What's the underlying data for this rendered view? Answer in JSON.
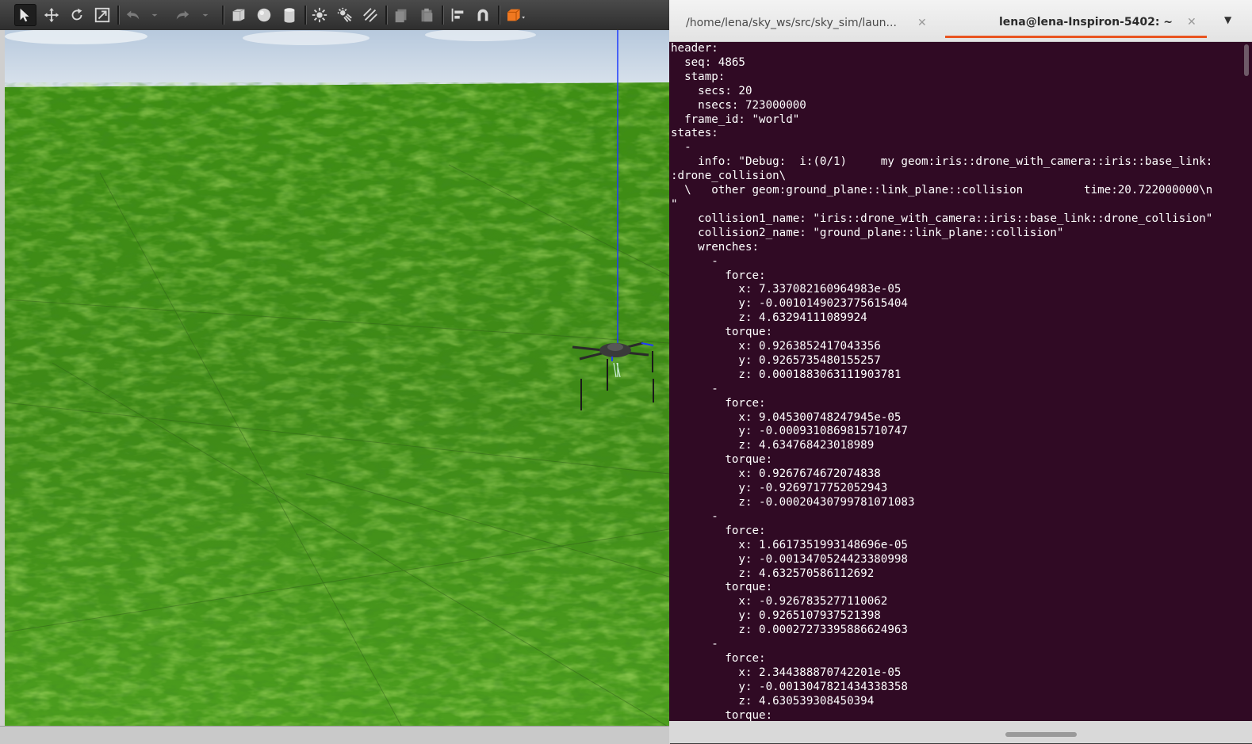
{
  "gazebo": {
    "toolbar": {
      "buttons": [
        {
          "name": "select-mode-button",
          "icon": "arrow-pointer-icon"
        },
        {
          "name": "translate-mode-button",
          "icon": "move-arrows-icon"
        },
        {
          "name": "rotate-mode-button",
          "icon": "rotate-icon"
        },
        {
          "name": "scale-mode-button",
          "icon": "scale-icon"
        },
        {
          "name": "undo-button",
          "icon": "undo-icon"
        },
        {
          "name": "redo-button",
          "icon": "redo-icon"
        },
        {
          "name": "box-shape-button",
          "icon": "box-icon"
        },
        {
          "name": "sphere-shape-button",
          "icon": "sphere-icon"
        },
        {
          "name": "cylinder-shape-button",
          "icon": "cylinder-icon"
        },
        {
          "name": "point-light-button",
          "icon": "point-light-icon"
        },
        {
          "name": "spot-light-button",
          "icon": "spot-light-icon"
        },
        {
          "name": "directional-light-button",
          "icon": "directional-light-icon"
        },
        {
          "name": "copy-button",
          "icon": "copy-icon"
        },
        {
          "name": "paste-button",
          "icon": "paste-icon"
        },
        {
          "name": "align-button",
          "icon": "align-icon"
        },
        {
          "name": "snap-button",
          "icon": "magnet-icon"
        },
        {
          "name": "view-angle-button",
          "icon": "view-cube-icon"
        }
      ]
    },
    "colors": {
      "sky": "#c9d7e6",
      "grass": "#3d8a15",
      "axis": "#1f3cff"
    }
  },
  "terminal": {
    "tabs": [
      {
        "label": "/home/lena/sky_ws/src/sky_sim/laun...",
        "active": false
      },
      {
        "label": "lena@lena-Inspiron-5402: ~",
        "active": true
      }
    ],
    "accent_color": "#e95420",
    "background_color": "#300a24",
    "lines": [
      "header:",
      "  seq: 4865",
      "  stamp:",
      "    secs: 20",
      "    nsecs: 723000000",
      "  frame_id: \"world\"",
      "states:",
      "  -",
      "    info: \"Debug:  i:(0/1)     my geom:iris::drone_with_camera::iris::base_link:",
      ":drone_collision\\",
      "  \\   other geom:ground_plane::link_plane::collision         time:20.722000000\\n",
      "\"",
      "    collision1_name: \"iris::drone_with_camera::iris::base_link::drone_collision\"",
      "    collision2_name: \"ground_plane::link_plane::collision\"",
      "    wrenches:",
      "      -",
      "        force:",
      "          x: 7.337082160964983e-05",
      "          y: -0.0010149023775615404",
      "          z: 4.63294111089924",
      "        torque:",
      "          x: 0.9263852417043356",
      "          y: 0.9265735480155257",
      "          z: 0.0001883063111903781",
      "      -",
      "        force:",
      "          x: 9.045300748247945e-05",
      "          y: -0.0009310869815710747",
      "          z: 4.634768423018989",
      "        torque:",
      "          x: 0.9267674672074838",
      "          y: -0.9269717752052943",
      "          z: -0.00020430799781071083",
      "      -",
      "        force:",
      "          x: 1.6617351993148696e-05",
      "          y: -0.0013470524423380998",
      "          z: 4.632570586112692",
      "        torque:",
      "          x: -0.9267835277110062",
      "          y: 0.9265107937521398",
      "          z: 0.00027273395886624963",
      "      -",
      "        force:",
      "          x: 2.344388870742201e-05",
      "          y: -0.0013047821434338358",
      "          z: 4.630539308450394",
      "        torque:"
    ]
  }
}
